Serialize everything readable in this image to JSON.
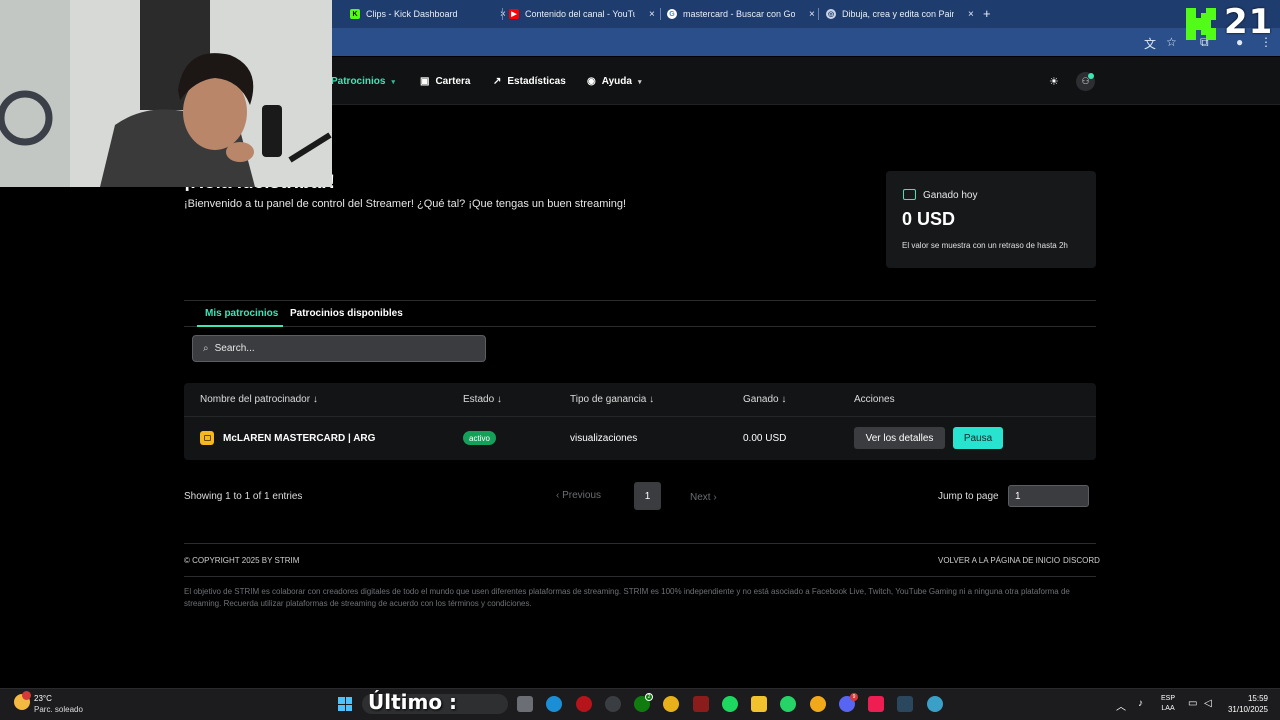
{
  "browser": {
    "tabs": [
      {
        "title": "Clips - Kick Dashboard",
        "favicon": "kick-icon"
      },
      {
        "title": "Contenido del canal - YouTube",
        "favicon": "youtube-icon"
      },
      {
        "title": "mastercard - Buscar con Google",
        "favicon": "google-icon"
      },
      {
        "title": "Dibuja, crea y edita con Paint | ",
        "favicon": "paint-icon"
      }
    ],
    "new_tab": "+",
    "close": "×"
  },
  "overlay": {
    "kick_number": "21"
  },
  "nav": {
    "items": [
      {
        "label": "Patrocinios",
        "icon": "sponsor-icon",
        "active": true,
        "dropdown": true
      },
      {
        "label": "Cartera",
        "icon": "wallet-icon",
        "active": false,
        "dropdown": false
      },
      {
        "label": "Estadísticas",
        "icon": "chart-icon",
        "active": false,
        "dropdown": false
      },
      {
        "label": "Ayuda",
        "icon": "help-icon",
        "active": false,
        "dropdown": true
      }
    ]
  },
  "greeting": {
    "title": "¡Hola lucistribar!",
    "subtitle": "¡Bienvenido a tu panel de control del Streamer! ¿Qué tal? ¡Que tengas un buen streaming!"
  },
  "earnings": {
    "label": "Ganado hoy",
    "value": "0 USD",
    "note": "El valor se muestra con un retraso de hasta 2h"
  },
  "tabs": {
    "mine": "Mis patrocinios",
    "available": "Patrocinios disponibles"
  },
  "search": {
    "placeholder": "Search..."
  },
  "table": {
    "headers": {
      "name": "Nombre del patrocinador ↓",
      "status": "Estado ↓",
      "type": "Tipo de ganancia ↓",
      "earned": "Ganado ↓",
      "actions": "Acciones"
    },
    "rows": [
      {
        "name": "McLAREN MASTERCARD | ARG",
        "status": "activo",
        "type": "visualizaciones",
        "earned": "0.00 USD",
        "details_label": "Ver los detalles",
        "pause_label": "Pausa"
      }
    ]
  },
  "pagination": {
    "showing": "Showing 1 to 1 of 1 entries",
    "prev": "‹   Previous",
    "current": "1",
    "next": "Next   ›",
    "jump_label": "Jump to page",
    "jump_value": "1"
  },
  "footer": {
    "copyright": "© COPYRIGHT 2025 BY STRIM",
    "home_link": "VOLVER A LA PÁGINA DE INICIO",
    "discord_link": "DISCORD",
    "disclaimer": "El objetivo de STRIM es colaborar con creadores digitales de todo el mundo que usen diferentes plataformas de streaming. STRIM es 100% independiente y no está asociado a Facebook Live, Twitch, YouTube Gaming ni a ninguna otra plataforma de streaming. Recuerda utilizar plataformas de streaming de acuerdo con los términos y condiciones."
  },
  "taskbar": {
    "weather_temp": "23°C",
    "weather_desc": "Parc. soleado",
    "search_text": "Último :",
    "lang_top": "ESP",
    "lang_bottom": "LAA",
    "time": "15:59",
    "date": "31/10/2025"
  },
  "colors": {
    "accent": "#3ee5b5",
    "pause_button": "#28e3cf",
    "status_active": "#15a05a",
    "sponsor_icon": "#f5b91e"
  }
}
